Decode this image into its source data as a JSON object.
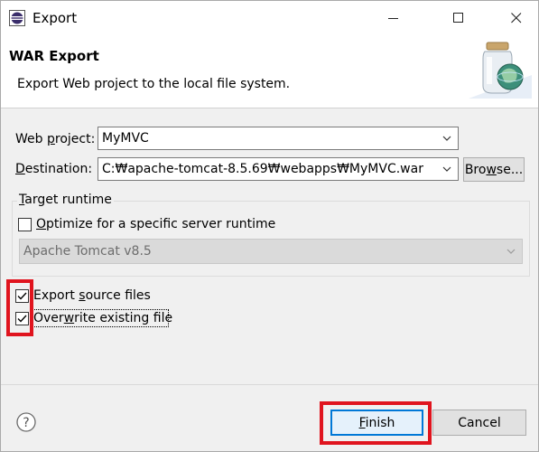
{
  "window": {
    "title": "Export",
    "minimize_glyph": "—",
    "maximize_glyph": "☐",
    "close_glyph": "✕"
  },
  "header": {
    "title": "WAR Export",
    "description": "Export Web project to the local file system."
  },
  "form": {
    "web_project": {
      "label_pre": "Web ",
      "label_u": "p",
      "label_post": "roject:",
      "value": "MyMVC"
    },
    "destination": {
      "label_pre": "",
      "label_u": "D",
      "label_post": "estination:",
      "value": "C:₩apache-tomcat-8.5.69₩webapps₩MyMVC.war"
    },
    "browse": {
      "label_pre": "Bro",
      "label_u": "w",
      "label_post": "se..."
    }
  },
  "target_runtime": {
    "title_pre": "",
    "title_u": "T",
    "title_post": "arget runtime",
    "optimize_pre": "",
    "optimize_u": "O",
    "optimize_post": "ptimize for a specific server runtime",
    "optimize_checked": false,
    "runtime_value": "Apache Tomcat v8.5"
  },
  "options": {
    "export_source": {
      "pre": "Export ",
      "u": "s",
      "post": "ource files",
      "checked": true
    },
    "overwrite": {
      "pre": "Over",
      "u": "w",
      "post": "rite existing file",
      "checked": true
    }
  },
  "footer": {
    "finish": {
      "pre": "",
      "u": "F",
      "post": "inish"
    },
    "cancel": "Cancel"
  },
  "icons": {
    "app": "eclipse-icon",
    "help": "help-icon",
    "header": "jar-globe-icon"
  },
  "colors": {
    "highlight": "#e0141e",
    "focus": "#0078d7"
  }
}
